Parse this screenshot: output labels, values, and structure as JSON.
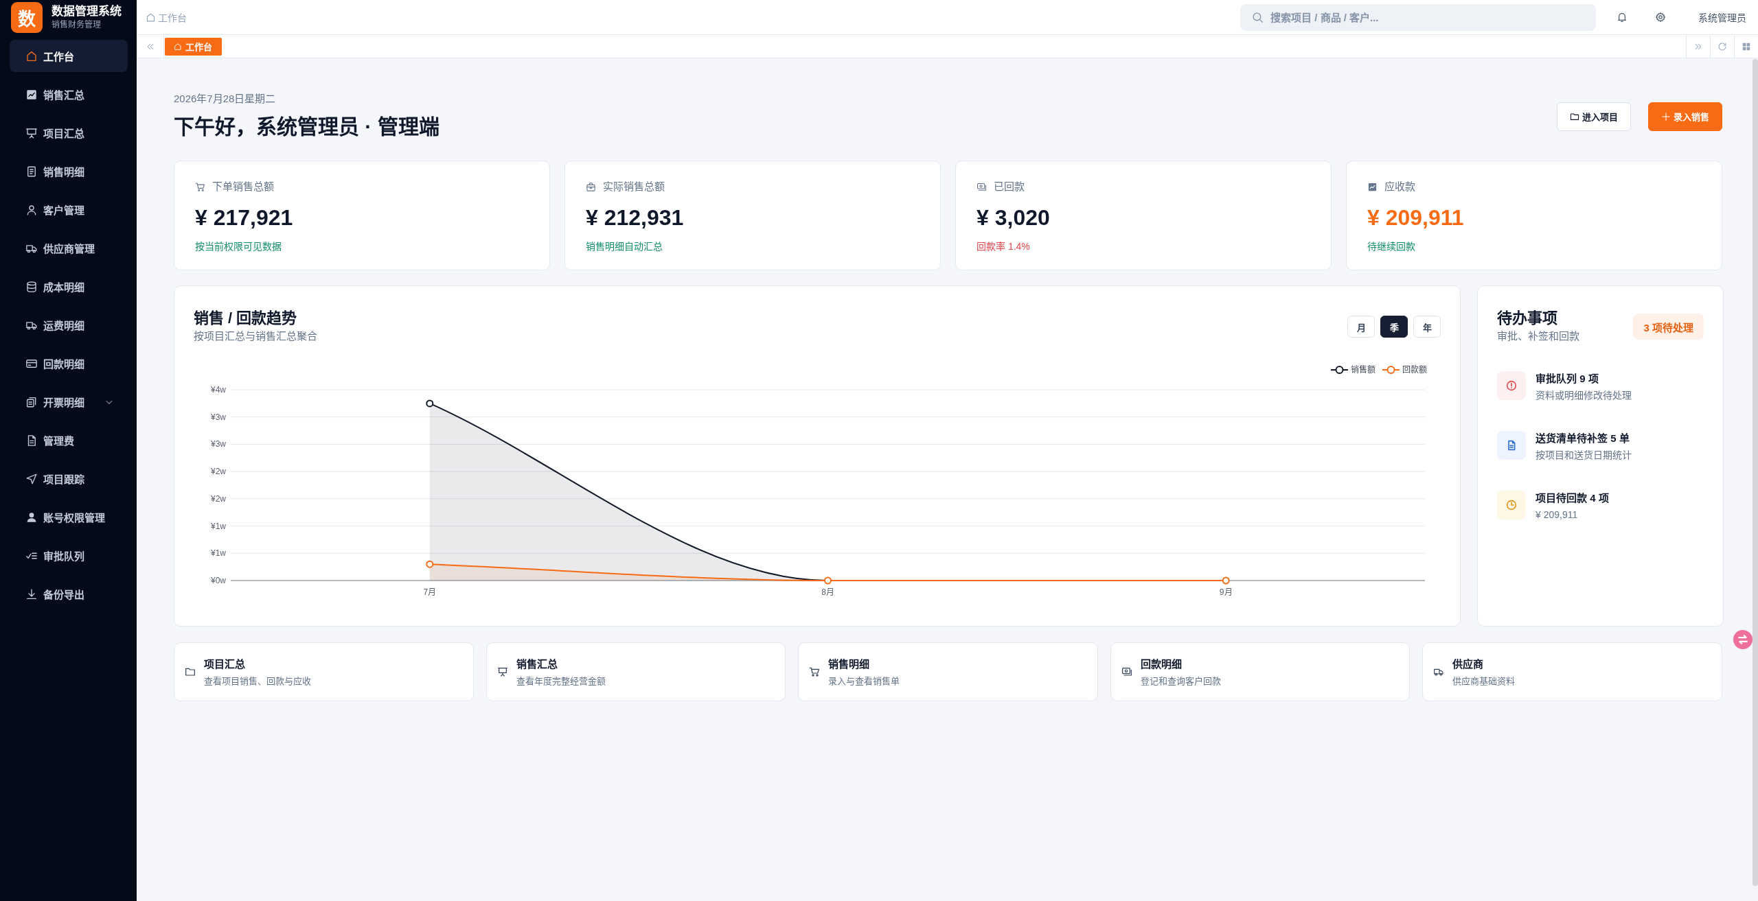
{
  "sidebar": {
    "logo": "数",
    "title": "数据管理系统",
    "subtitle": "销售财务管理",
    "items": [
      {
        "label": "工作台",
        "kind": "link",
        "selected": true
      },
      {
        "label": "销售汇总",
        "kind": "link",
        "selected": false
      },
      {
        "label": "项目汇总",
        "kind": "link",
        "selected": false
      },
      {
        "label": "销售明细",
        "kind": "link",
        "selected": false
      },
      {
        "label": "客户管理",
        "kind": "link",
        "selected": false
      },
      {
        "label": "供应商管理",
        "kind": "link",
        "selected": false
      },
      {
        "label": "成本明细",
        "kind": "link",
        "selected": false
      },
      {
        "label": "运费明细",
        "kind": "link",
        "selected": false
      },
      {
        "label": "回款明细",
        "kind": "link",
        "selected": false
      },
      {
        "label": "开票明细",
        "kind": "group",
        "expanded": false,
        "selected": false
      },
      {
        "label": "管理费",
        "kind": "link",
        "selected": false
      },
      {
        "label": "项目跟踪",
        "kind": "link",
        "selected": false
      },
      {
        "label": "账号权限管理",
        "kind": "link",
        "selected": false
      },
      {
        "label": "审批队列",
        "kind": "link",
        "selected": false
      },
      {
        "label": "备份导出",
        "kind": "link",
        "selected": false
      }
    ]
  },
  "topbar": {
    "breadcrumb": [
      {
        "label": "工作台"
      }
    ],
    "search": {
      "placeholder": "搜索项目 / 商品 / 客户..."
    },
    "user": "系统管理员"
  },
  "tabs": [
    {
      "label": "工作台",
      "selected": true
    }
  ],
  "header": {
    "date": "2026年7月28日星期二",
    "greeting": "下午好，系统管理员 · 管理端",
    "buttons": [
      {
        "label": "进入项目",
        "kind": "secondary"
      },
      {
        "label": "录入销售",
        "kind": "primary"
      }
    ]
  },
  "stats": [
    {
      "label": "下单销售总额",
      "value": "¥ 217,921",
      "highlighted": false,
      "note": "按当前权限可见数据",
      "color": "#14906c"
    },
    {
      "label": "实际销售总额",
      "value": "¥ 212,931",
      "highlighted": false,
      "note": "销售明细自动汇总",
      "color": "#14906c"
    },
    {
      "label": "已回款",
      "value": "¥ 3,020",
      "highlighted": false,
      "note": "回款率 1.4%",
      "color": "#e5484d"
    },
    {
      "label": "应收款",
      "value": "¥ 209,911",
      "highlighted": true,
      "note": "待继续回款",
      "color": "#14906c"
    }
  ],
  "trend_panel": {
    "title": "销售 / 回款趋势",
    "subtitle": "按项目汇总与销售汇总聚合",
    "periods": [
      {
        "label": "月",
        "selected": false
      },
      {
        "label": "季",
        "selected": true
      },
      {
        "label": "年",
        "selected": false
      }
    ],
    "chart_data": {
      "type": "area",
      "categories": [
        "7月",
        "8月",
        "9月"
      ],
      "series": [
        {
          "name": "销售额",
          "color": "#111827",
          "values": [
            3.25,
            0,
            0
          ]
        },
        {
          "name": "回款额",
          "color": "#f76b15",
          "values": [
            0.3,
            0,
            0
          ]
        }
      ],
      "ylim": [
        0,
        3.5
      ],
      "yticks": [
        {
          "value": 0,
          "label": "¥0w"
        },
        {
          "value": 0.5,
          "label": "¥1w"
        },
        {
          "value": 1,
          "label": "¥1w"
        },
        {
          "value": 1.5,
          "label": "¥2w"
        },
        {
          "value": 2,
          "label": "¥2w"
        },
        {
          "value": 2.5,
          "label": "¥3w"
        },
        {
          "value": 3,
          "label": "¥3w"
        },
        {
          "value": 3.5,
          "label": "¥4w"
        }
      ],
      "grid": true,
      "legend": "top-right"
    }
  },
  "todo_panel": {
    "title": "待办事项",
    "subtitle": "审批、补签和回款",
    "badge": "3 项待处理",
    "items": [
      {
        "kind": "alert",
        "title": "审批队列 9 项",
        "detail": "资料或明细修改待处理"
      },
      {
        "kind": "document",
        "title": "送货清单待补签 5 单",
        "detail": "按项目和送货日期统计"
      },
      {
        "kind": "clock",
        "title": "项目待回款 4 项",
        "detail": "¥ 209,911"
      }
    ]
  },
  "shortcuts": [
    {
      "title": "项目汇总",
      "subtitle": "查看项目销售、回款与应收"
    },
    {
      "title": "销售汇总",
      "subtitle": "查看年度完整经营金额"
    },
    {
      "title": "销售明细",
      "subtitle": "录入与查看销售单"
    },
    {
      "title": "回款明细",
      "subtitle": "登记和查询客户回款"
    },
    {
      "title": "供应商",
      "subtitle": "供应商基础资料"
    }
  ]
}
